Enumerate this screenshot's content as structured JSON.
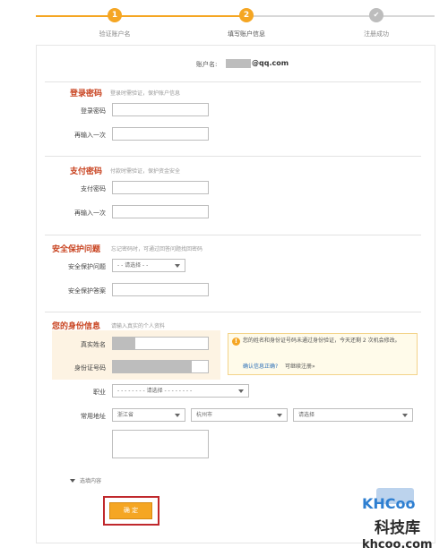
{
  "stepper": {
    "steps": [
      {
        "num": "1",
        "label": "验证账户名"
      },
      {
        "num": "2",
        "label": "填写账户信息"
      },
      {
        "num": "✔",
        "label": "注册成功"
      }
    ],
    "colors": {
      "done": "#f5a623",
      "pending": "#bdbdbd"
    }
  },
  "account": {
    "label": "账户名:",
    "suffix": "@qq.com"
  },
  "login_pw": {
    "title": "登录密码",
    "hint": "登录时需验证，保护账户信息",
    "pw_label": "登录密码",
    "confirm_label": "再输入一次"
  },
  "pay_pw": {
    "title": "支付密码",
    "hint": "付款时需验证，保护资金安全",
    "pw_label": "支付密码",
    "confirm_label": "再输入一次"
  },
  "security": {
    "title": "安全保护问题",
    "hint": "忘记密码时，可通过回答问题找回密码",
    "question_label": "安全保护问题",
    "question_value": "- - 请选择 - -",
    "answer_label": "安全保护答案"
  },
  "identity": {
    "title": "您的身份信息",
    "hint": "请输入真实的个人资料",
    "name_label": "真实姓名",
    "id_label": "身份证号码",
    "notice_text": "您的姓名和身份证号码未通过身份验证，今天还剩 2 次机会修改。",
    "notice_count": "2",
    "notice_link": "确认信息正确?",
    "notice_continue": "可继续注册»",
    "job_label": "职业",
    "job_value": "- - - - - - - - 请选择 - - - - - - - -",
    "address_label": "常用地址",
    "province": "浙江省",
    "city": "杭州市",
    "district": "请选择"
  },
  "optional": {
    "label": "选填内容"
  },
  "submit": {
    "label": "确 定"
  },
  "watermark": {
    "logo": "KHCoo",
    "name": "科技库",
    "domain": "khcoo.com"
  }
}
